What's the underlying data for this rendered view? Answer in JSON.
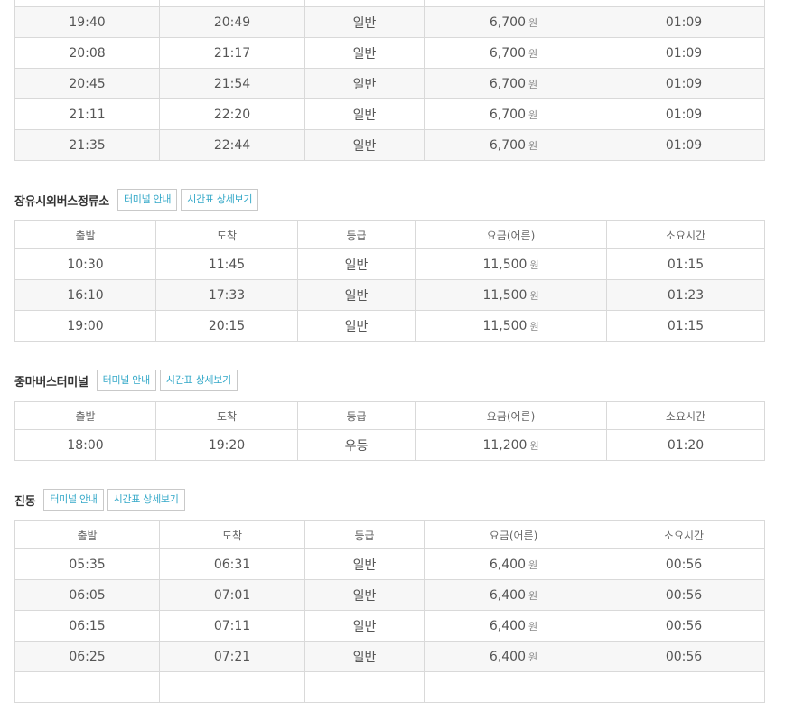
{
  "currency_unit": "원",
  "headers": {
    "depart": "출발",
    "arrive": "도착",
    "grade": "등급",
    "fare": "요금(어른)",
    "duration": "소요시간"
  },
  "buttons": {
    "terminal_info": "터미널 안내",
    "timetable_detail": "시간표 상세보기"
  },
  "top_table": {
    "rows": [
      {
        "depart": "19:40",
        "arrive": "20:49",
        "grade": "일반",
        "fare": "6,700",
        "duration": "01:09"
      },
      {
        "depart": "20:08",
        "arrive": "21:17",
        "grade": "일반",
        "fare": "6,700",
        "duration": "01:09"
      },
      {
        "depart": "20:45",
        "arrive": "21:54",
        "grade": "일반",
        "fare": "6,700",
        "duration": "01:09"
      },
      {
        "depart": "21:11",
        "arrive": "22:20",
        "grade": "일반",
        "fare": "6,700",
        "duration": "01:09"
      },
      {
        "depart": "21:35",
        "arrive": "22:44",
        "grade": "일반",
        "fare": "6,700",
        "duration": "01:09"
      }
    ]
  },
  "sections": [
    {
      "title": "장유시외버스정류소",
      "rows": [
        {
          "depart": "10:30",
          "arrive": "11:45",
          "grade": "일반",
          "fare": "11,500",
          "duration": "01:15"
        },
        {
          "depart": "16:10",
          "arrive": "17:33",
          "grade": "일반",
          "fare": "11,500",
          "duration": "01:23"
        },
        {
          "depart": "19:00",
          "arrive": "20:15",
          "grade": "일반",
          "fare": "11,500",
          "duration": "01:15"
        }
      ]
    },
    {
      "title": "중마버스터미널",
      "rows": [
        {
          "depart": "18:00",
          "arrive": "19:20",
          "grade": "우등",
          "fare": "11,200",
          "duration": "01:20"
        }
      ]
    },
    {
      "title": "진동",
      "rows": [
        {
          "depart": "05:35",
          "arrive": "06:31",
          "grade": "일반",
          "fare": "6,400",
          "duration": "00:56"
        },
        {
          "depart": "06:05",
          "arrive": "07:01",
          "grade": "일반",
          "fare": "6,400",
          "duration": "00:56"
        },
        {
          "depart": "06:15",
          "arrive": "07:11",
          "grade": "일반",
          "fare": "6,400",
          "duration": "00:56"
        },
        {
          "depart": "06:25",
          "arrive": "07:21",
          "grade": "일반",
          "fare": "6,400",
          "duration": "00:56"
        }
      ]
    }
  ]
}
